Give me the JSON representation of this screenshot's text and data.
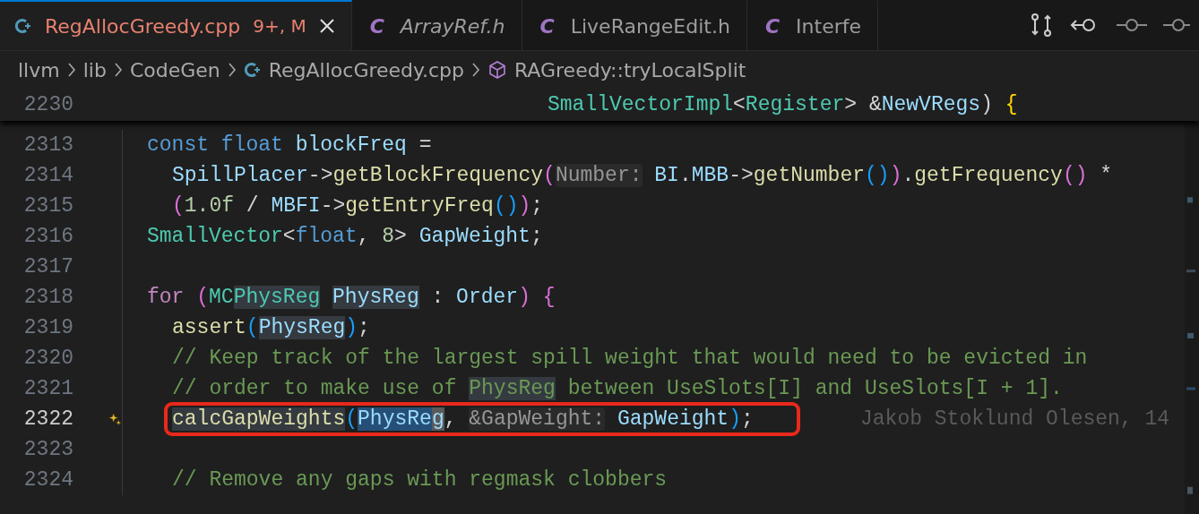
{
  "tabs": [
    {
      "kind": "cpp",
      "label": "RegAllocGreedy.cpp",
      "status": "9+, M",
      "selected": true,
      "preview": false
    },
    {
      "kind": "header",
      "icon_text": "C",
      "label": "ArrayRef.h",
      "selected": false,
      "preview": true
    },
    {
      "kind": "header",
      "icon_text": "C",
      "label": "LiveRangeEdit.h",
      "selected": false,
      "preview": false
    },
    {
      "kind": "header",
      "icon_text": "C",
      "label": "Interfe",
      "selected": false,
      "preview": false
    }
  ],
  "breadcrumbs": [
    {
      "kind": "folder",
      "label": "llvm"
    },
    {
      "kind": "folder",
      "label": "lib"
    },
    {
      "kind": "folder",
      "label": "CodeGen"
    },
    {
      "kind": "cpp",
      "label": "RegAllocGreedy.cpp"
    },
    {
      "kind": "symbol",
      "label": "RAGreedy::tryLocalSplit"
    }
  ],
  "sticky_line": {
    "number": "2230",
    "tokens": [
      {
        "text": "SmallVectorImpl",
        "kind": "type"
      },
      {
        "text": "<",
        "kind": "punct"
      },
      {
        "text": "Register",
        "kind": "type"
      },
      {
        "text": "> &",
        "kind": "punct"
      },
      {
        "text": "NewVRegs",
        "kind": "var"
      },
      {
        "text": ") ",
        "kind": "punct"
      },
      {
        "text": "{",
        "kind": "b1"
      }
    ]
  },
  "lines": [
    {
      "number": "2313",
      "current": false,
      "outlined": false,
      "tokens": [
        {
          "text": "const float ",
          "kind": "kw"
        },
        {
          "text": "blockFreq",
          "kind": "var"
        },
        {
          "text": " =",
          "kind": "punct"
        }
      ],
      "children": [
        {
          "number": "2314",
          "current": false,
          "outlined": false,
          "tokens": [
            {
              "text": "SpillPlacer",
              "kind": "var"
            },
            {
              "text": "->",
              "kind": "punct"
            },
            {
              "text": "getBlockFrequency",
              "kind": "func"
            },
            {
              "text": "(",
              "kind": "b2"
            },
            {
              "text": "Number:",
              "kind": "hint"
            },
            {
              "text": " BI",
              "kind": "var"
            },
            {
              "text": ".",
              "kind": "punct"
            },
            {
              "text": "MBB",
              "kind": "var"
            },
            {
              "text": "->",
              "kind": "punct"
            },
            {
              "text": "getNumber",
              "kind": "func"
            },
            {
              "text": "()",
              "kind": "b3"
            },
            {
              "text": ")",
              "kind": "b2"
            },
            {
              "text": ".",
              "kind": "punct"
            },
            {
              "text": "getFrequency",
              "kind": "func"
            },
            {
              "text": "()",
              "kind": "b2"
            },
            {
              "text": " *",
              "kind": "punct"
            }
          ]
        },
        {
          "number": "2315",
          "current": false,
          "outlined": false,
          "tokens": [
            {
              "text": "(",
              "kind": "b2"
            },
            {
              "text": "1.0f",
              "kind": "num"
            },
            {
              "text": " / ",
              "kind": "punct"
            },
            {
              "text": "MBFI",
              "kind": "var"
            },
            {
              "text": "->",
              "kind": "punct"
            },
            {
              "text": "getEntryFreq",
              "kind": "func"
            },
            {
              "text": "()",
              "kind": "b3"
            },
            {
              "text": ")",
              "kind": "b2"
            },
            {
              "text": ";",
              "kind": "punct"
            }
          ]
        }
      ]
    },
    {
      "number": "2316",
      "current": false,
      "outlined": false,
      "tokens": [
        {
          "text": "SmallVector",
          "kind": "type"
        },
        {
          "text": "<",
          "kind": "punct"
        },
        {
          "text": "float",
          "kind": "kw"
        },
        {
          "text": ", ",
          "kind": "punct"
        },
        {
          "text": "8",
          "kind": "num"
        },
        {
          "text": "> ",
          "kind": "punct"
        },
        {
          "text": "GapWeight",
          "kind": "var"
        },
        {
          "text": ";",
          "kind": "punct"
        }
      ]
    },
    {
      "number": "2317",
      "current": false,
      "outlined": false
    },
    {
      "number": "2318",
      "current": false,
      "outlined": false,
      "tokens": [
        {
          "text": "for ",
          "kind": "ctrl"
        },
        {
          "text": "(",
          "kind": "b2"
        },
        {
          "text": "MC",
          "kind": "type"
        },
        {
          "text": "PhysReg",
          "kind": "type",
          "word_highlight": true
        },
        {
          "text": "PhysReg",
          "kind": "var",
          "word_highlight": true,
          "space_before": true
        },
        {
          "text": " : ",
          "kind": "punct"
        },
        {
          "text": "Order",
          "kind": "var"
        },
        {
          "text": ")",
          "kind": "b2"
        },
        {
          "text": " {",
          "kind": "b2"
        }
      ],
      "children": [
        {
          "number": "2319",
          "current": false,
          "outlined": false,
          "tokens": [
            {
              "text": "assert",
              "kind": "func"
            },
            {
              "text": "(",
              "kind": "b3"
            },
            {
              "text": "PhysReg",
              "kind": "var",
              "word_highlight": true
            },
            {
              "text": ")",
              "kind": "b3"
            },
            {
              "text": ";",
              "kind": "punct"
            }
          ]
        },
        {
          "number": "2320",
          "current": false,
          "outlined": false,
          "tokens": [
            {
              "text": "// Keep track of the largest spill weight that would need to be evicted in",
              "kind": "comment"
            }
          ]
        },
        {
          "number": "2321",
          "current": false,
          "outlined": false,
          "tokens": [
            {
              "text": "// order to make use of ",
              "kind": "comment"
            },
            {
              "text": "PhysReg",
              "kind": "comment",
              "word_highlight": true
            },
            {
              "text": " between UseSlots[I] and UseSlots[I + 1].",
              "kind": "comment"
            }
          ]
        },
        {
          "number": "2322",
          "current": true,
          "outlined": true,
          "blame": "Jakob Stoklund Olesen, 14",
          "tokens": [
            {
              "text": "calcGapWeights",
              "kind": "func",
              "word_highlight": true
            },
            {
              "text": "(",
              "kind": "b3"
            },
            {
              "text": "PhysRe",
              "kind": "var",
              "selected": true
            },
            {
              "text": "g",
              "kind": "var",
              "cursor": true
            },
            {
              "text": ", ",
              "kind": "punct"
            },
            {
              "text": "&GapWeight:",
              "kind": "hint"
            },
            {
              "text": " GapWeight",
              "kind": "var"
            },
            {
              "text": ")",
              "kind": "b3"
            },
            {
              "text": ";",
              "kind": "punct"
            }
          ]
        },
        {
          "number": "2323",
          "current": false,
          "outlined": false
        },
        {
          "number": "2324",
          "current": false,
          "outlined": false,
          "tokens": [
            {
              "text": "// Remove any gaps with regmask clobbers",
              "kind": "comment"
            }
          ]
        }
      ]
    }
  ]
}
